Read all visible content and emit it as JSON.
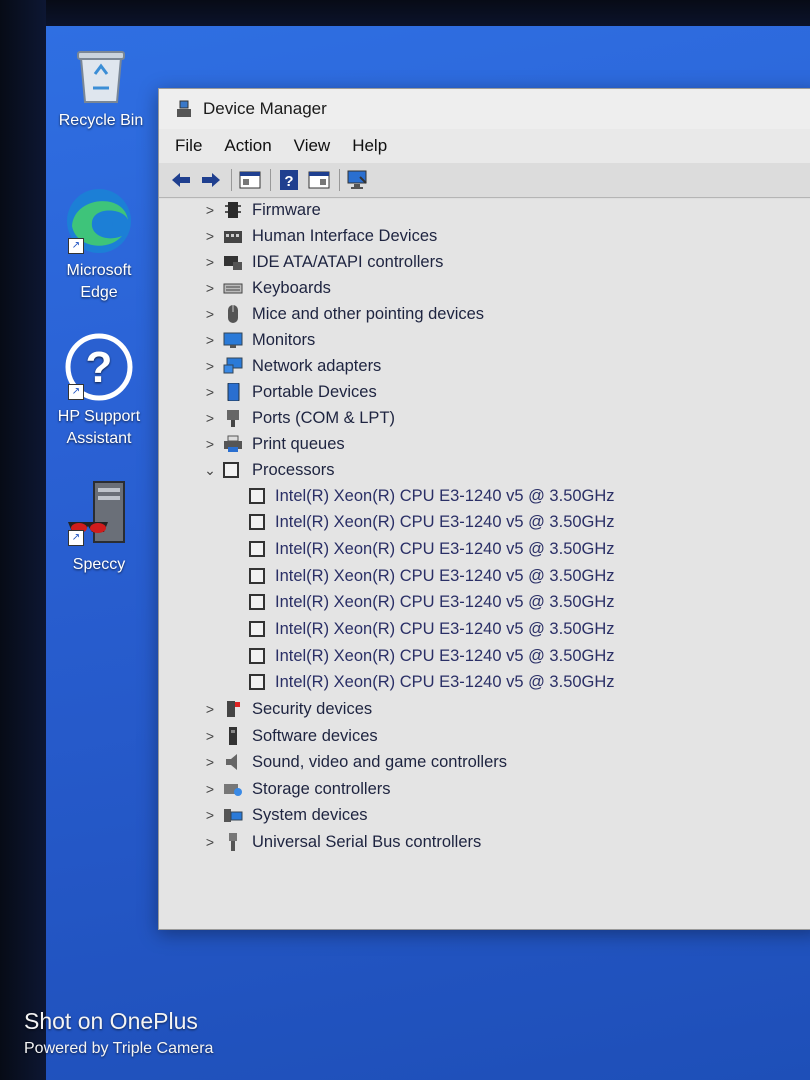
{
  "desktop": {
    "icons": [
      {
        "label": "Recycle Bin",
        "icon": "recycle-bin-icon"
      },
      {
        "label": "Microsoft Edge",
        "icon": "edge-icon"
      },
      {
        "label": "HP Support Assistant",
        "icon": "hp-support-icon"
      },
      {
        "label": "Speccy",
        "icon": "speccy-icon"
      }
    ]
  },
  "window": {
    "title": "Device Manager",
    "menu": [
      "File",
      "Action",
      "View",
      "Help"
    ],
    "toolbar": [
      "back-arrow-icon",
      "forward-arrow-icon",
      "properties-icon",
      "help-icon",
      "view-icon",
      "scan-hardware-icon"
    ],
    "tree": {
      "categories_before": [
        "Firmware",
        "Human Interface Devices",
        "IDE ATA/ATAPI controllers",
        "Keyboards",
        "Mice and other pointing devices",
        "Monitors",
        "Network adapters",
        "Portable Devices",
        "Ports (COM & LPT)",
        "Print queues"
      ],
      "expanded": {
        "label": "Processors",
        "children": [
          "Intel(R) Xeon(R) CPU E3-1240 v5 @ 3.50GHz",
          "Intel(R) Xeon(R) CPU E3-1240 v5 @ 3.50GHz",
          "Intel(R) Xeon(R) CPU E3-1240 v5 @ 3.50GHz",
          "Intel(R) Xeon(R) CPU E3-1240 v5 @ 3.50GHz",
          "Intel(R) Xeon(R) CPU E3-1240 v5 @ 3.50GHz",
          "Intel(R) Xeon(R) CPU E3-1240 v5 @ 3.50GHz",
          "Intel(R) Xeon(R) CPU E3-1240 v5 @ 3.50GHz",
          "Intel(R) Xeon(R) CPU E3-1240 v5 @ 3.50GHz"
        ]
      },
      "categories_after": [
        "Security devices",
        "Software devices",
        "Sound, video and game controllers",
        "Storage controllers",
        "System devices",
        "Universal Serial Bus controllers"
      ]
    }
  },
  "watermark": {
    "line1": "Shot on OnePlus",
    "line2": "Powered by Triple Camera"
  }
}
